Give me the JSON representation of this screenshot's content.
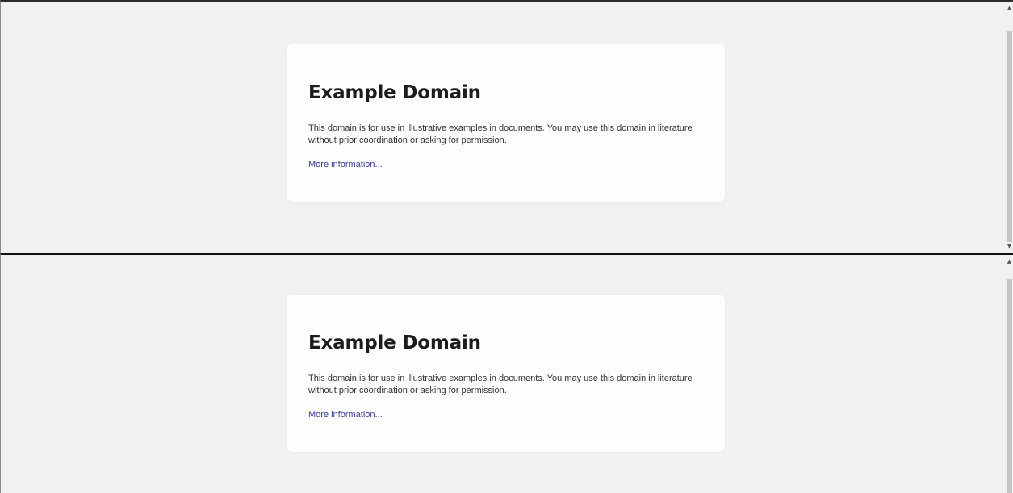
{
  "panes": [
    {
      "heading": "Example Domain",
      "body": "This domain is for use in illustrative examples in documents. You may use this domain in literature without prior coordination or asking for permission.",
      "link": "More information..."
    },
    {
      "heading": "Example Domain",
      "body": "This domain is for use in illustrative examples in documents. You may use this domain in literature without prior coordination or asking for permission.",
      "link": "More information..."
    }
  ],
  "colors": {
    "page_background": "#f1f1f2",
    "card_background": "#fdfdff",
    "link": "#3a3f8f",
    "divider": "#111111",
    "scroll_thumb": "#c6c6c6"
  },
  "icons": {
    "scroll_up": "scroll-up-arrow-icon",
    "scroll_down": "scroll-down-arrow-icon"
  }
}
